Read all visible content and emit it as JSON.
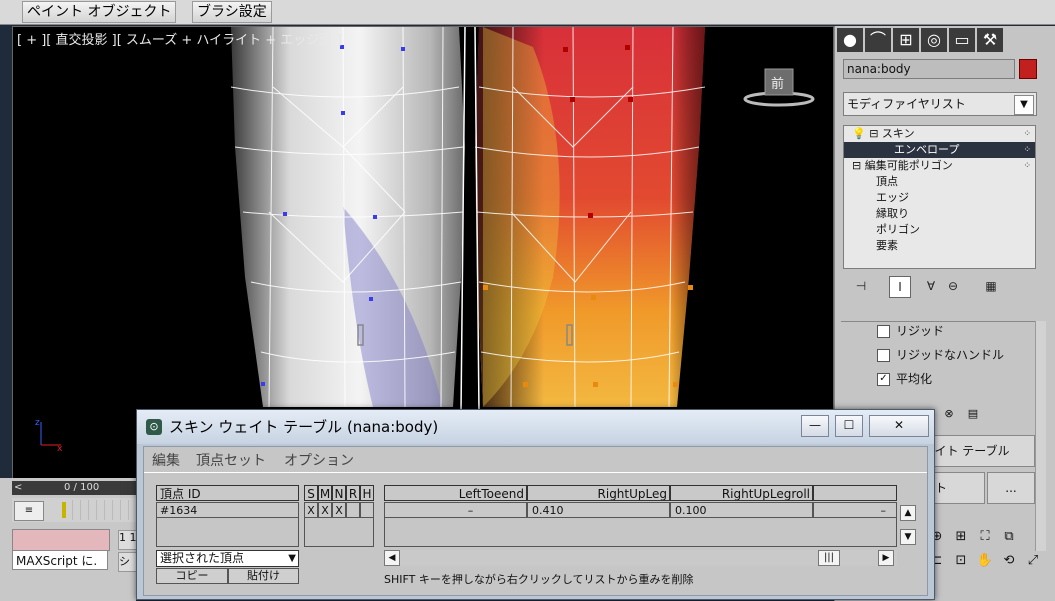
{
  "top_tabs": [
    "ペイント オブジェクト",
    "ブラシ設定"
  ],
  "viewport": {
    "label": "[ + ][ 直交投影 ][ スムーズ + ハイライト + エッジ面 ]",
    "viewcube_label": "前",
    "timeslider_text": "0 / 100",
    "timeslider_left": "<"
  },
  "left_bottom": {
    "maxscript_text": "MAXScript に.",
    "mini1": "1 1",
    "mini2": "シ"
  },
  "command_panel": {
    "tab_icons": [
      "sphere-icon",
      "curve-icon",
      "hierarchy-icon",
      "motion-icon",
      "display-icon",
      "hammer-icon"
    ],
    "object_name": "nana:body",
    "object_color": "#c21f1f",
    "modifier_list": "モディファイヤリスト",
    "stack": [
      {
        "label": "スキン",
        "indent": 0,
        "selected": false
      },
      {
        "label": "エンベロープ",
        "indent": 3,
        "selected": true
      },
      {
        "label": "編集可能ポリゴン",
        "indent": 0,
        "selected": false
      },
      {
        "label": "頂点",
        "indent": 2,
        "selected": false
      },
      {
        "label": "エッジ",
        "indent": 2,
        "selected": false
      },
      {
        "label": "縁取り",
        "indent": 2,
        "selected": false
      },
      {
        "label": "ポリゴン",
        "indent": 2,
        "selected": false
      },
      {
        "label": "要素",
        "indent": 2,
        "selected": false
      }
    ],
    "checkboxes": [
      {
        "label": "リジッド",
        "checked": false
      },
      {
        "label": "リジッドなハンドル",
        "checked": false
      },
      {
        "label": "平均化",
        "checked": true
      }
    ],
    "weight_table_button": "ウェイト テーブル",
    "bottom_button1": "イト",
    "bottom_button2": "..."
  },
  "dialog": {
    "title": "スキン ウェイト テーブル (nana:body)",
    "window_buttons": {
      "minimize": "—",
      "maximize": "☐",
      "close": "✕"
    },
    "menu": [
      "編集",
      "頂点セット",
      "オプション"
    ],
    "headers": {
      "vertex_id": "頂点 ID",
      "flags": [
        "S",
        "M",
        "N",
        "R",
        "H"
      ],
      "bones": [
        "LeftToeend",
        "RightUpLeg",
        "RightUpLegroll",
        ""
      ]
    },
    "row": {
      "vertex": "#1634",
      "flags": [
        "X",
        "X",
        "X",
        "",
        ""
      ],
      "values": [
        "–",
        "0.410",
        "0.100",
        "–"
      ]
    },
    "vertex_set": "選択された頂点",
    "copy": "コピー",
    "paste": "貼付け",
    "hint": "SHIFT キーを押しながら右クリックしてリストから重みを削除"
  }
}
